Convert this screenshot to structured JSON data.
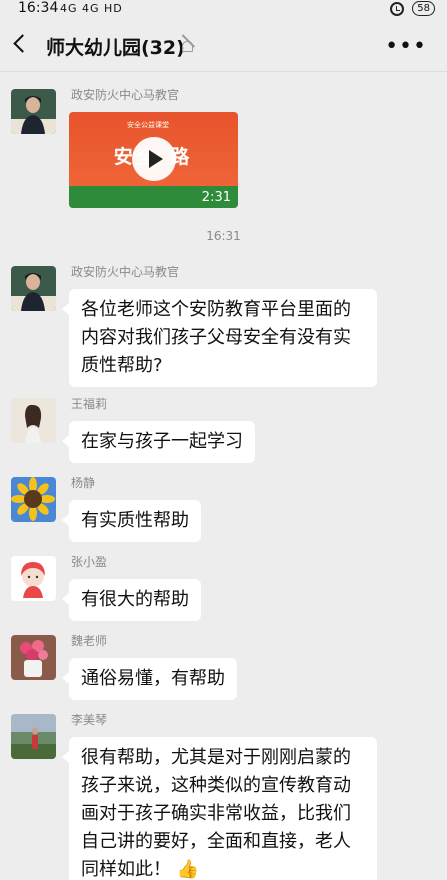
{
  "status_bar": {
    "time": "16:34",
    "network": "4G 4G HD",
    "battery": "58"
  },
  "header": {
    "title": "师大幼儿园(32)"
  },
  "messages": [
    {
      "sender": "政安防火中心马教官",
      "type": "video",
      "video_title": "安全 路",
      "video_logo": "安全公益课堂",
      "duration": "2:31"
    },
    {
      "type": "time",
      "text": "16:31"
    },
    {
      "sender": "政安防火中心马教官",
      "text": "各位老师这个安防教育平台里面的内容对我们孩子父母安全有没有实质性帮助?"
    },
    {
      "sender": "王福莉",
      "text": "在家与孩子一起学习"
    },
    {
      "sender": "杨静",
      "text": "有实质性帮助"
    },
    {
      "sender": "张小盈",
      "text": "有很大的帮助"
    },
    {
      "sender": "魏老师",
      "text": "通俗易懂，有帮助"
    },
    {
      "sender": "李美琴",
      "text": "很有帮助，尤其是对于刚刚启蒙的孩子来说，这种类似的宣传教育动画对于孩子确实非常收益，比我们自己讲的要好，全面和直接，老人同样如此！",
      "emoji": "thumbs-up"
    }
  ],
  "colors": {
    "background": "#ededed",
    "bubble": "#ffffff",
    "sender": "#8a8a8a",
    "video": "#e8532d"
  }
}
